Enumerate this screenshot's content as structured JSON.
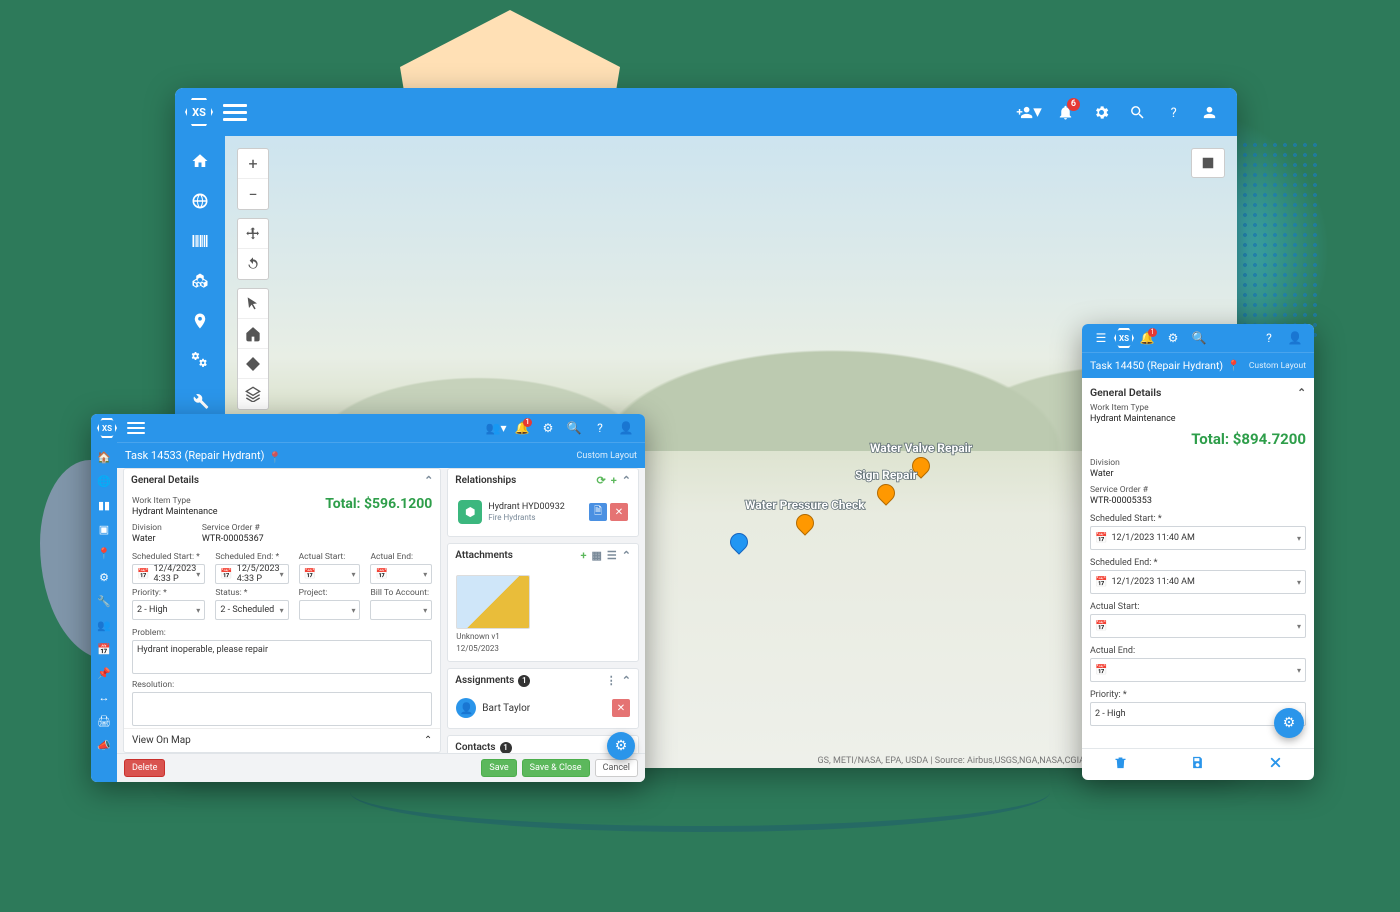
{
  "logo_text": "XS",
  "main": {
    "notification_count": "6",
    "map_labels": {
      "valve": "Water Valve Repair",
      "sign": "Sign Repair",
      "pressure": "Water Pressure Check"
    },
    "attribution": "GS, METI/NASA, EPA, USDA | Source: Airbus,USGS,NGA,NASA,CGIAR,NLS,OS,NMA,Geodatastyrelsen,G..."
  },
  "left_window": {
    "notification_count": "1",
    "title": "Task 14533 (Repair Hydrant)",
    "custom_layout": "Custom Layout",
    "general_details": {
      "header": "General Details",
      "work_item_type_label": "Work Item Type",
      "work_item_type": "Hydrant Maintenance",
      "total_label": "Total:",
      "total_value": "$596.1200",
      "division_label": "Division",
      "division": "Water",
      "service_order_label": "Service Order #",
      "service_order": "WTR-00005367",
      "scheduled_start_label": "Scheduled Start: *",
      "scheduled_start": "12/4/2023 4:33 P",
      "scheduled_end_label": "Scheduled End: *",
      "scheduled_end": "12/5/2023 4:33 P",
      "actual_start_label": "Actual Start:",
      "actual_start": "",
      "actual_end_label": "Actual End:",
      "actual_end": "",
      "priority_label": "Priority: *",
      "priority": "2 - High",
      "status_label": "Status: *",
      "status": "2 - Scheduled",
      "project_label": "Project:",
      "project": "",
      "bill_to_label": "Bill To Account:",
      "bill_to": "",
      "problem_label": "Problem:",
      "problem": "Hydrant inoperable, please repair",
      "resolution_label": "Resolution:",
      "resolution": ""
    },
    "relationships": {
      "header": "Relationships",
      "item_title": "Hydrant HYD00932",
      "item_sub": "Fire Hydrants"
    },
    "attachments": {
      "header": "Attachments",
      "name": "Unknown v1",
      "date": "12/05/2023"
    },
    "assignments": {
      "header": "Assignments",
      "count": "1",
      "person": "Bart Taylor"
    },
    "contacts": {
      "header": "Contacts",
      "count": "1"
    },
    "view_on_map": "View On Map",
    "buttons": {
      "delete": "Delete",
      "save": "Save",
      "save_close": "Save & Close",
      "cancel": "Cancel"
    }
  },
  "right_window": {
    "notification_count": "1",
    "title": "Task 14450 (Repair Hydrant)",
    "custom_layout": "Custom Layout",
    "general_details_header": "General Details",
    "work_item_type_label": "Work Item Type",
    "work_item_type": "Hydrant Maintenance",
    "total_label": "Total:",
    "total_value": "$894.7200",
    "division_label": "Division",
    "division": "Water",
    "service_order_label": "Service Order #",
    "service_order": "WTR-00005353",
    "scheduled_start_label": "Scheduled Start: *",
    "scheduled_start": "12/1/2023 11:40 AM",
    "scheduled_end_label": "Scheduled End: *",
    "scheduled_end": "12/1/2023 11:40 AM",
    "actual_start_label": "Actual Start:",
    "actual_start": "",
    "actual_end_label": "Actual End:",
    "actual_end": "",
    "priority_label": "Priority: *",
    "priority": "2 - High"
  }
}
